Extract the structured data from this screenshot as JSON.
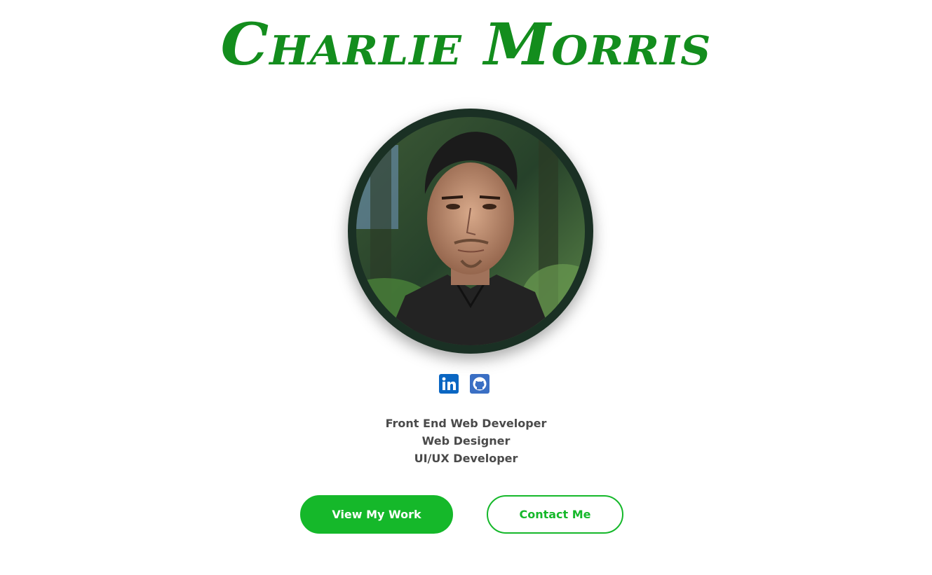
{
  "header": {
    "name": "Charlie Morris"
  },
  "profile": {
    "avatar_alt": "Charlie Morris portrait"
  },
  "social": [
    {
      "icon": "linkedin-icon",
      "color": "#0a66c2"
    },
    {
      "icon": "github-icon",
      "color": "#3a6fc4"
    }
  ],
  "roles": [
    "Front End Web Developer",
    "Web Designer",
    "UI/UX Developer"
  ],
  "actions": {
    "primary_label": "View My Work",
    "secondary_label": "Contact Me"
  },
  "colors": {
    "accent": "#15b82a",
    "title": "#138d1d",
    "frame": "#1a3024"
  }
}
